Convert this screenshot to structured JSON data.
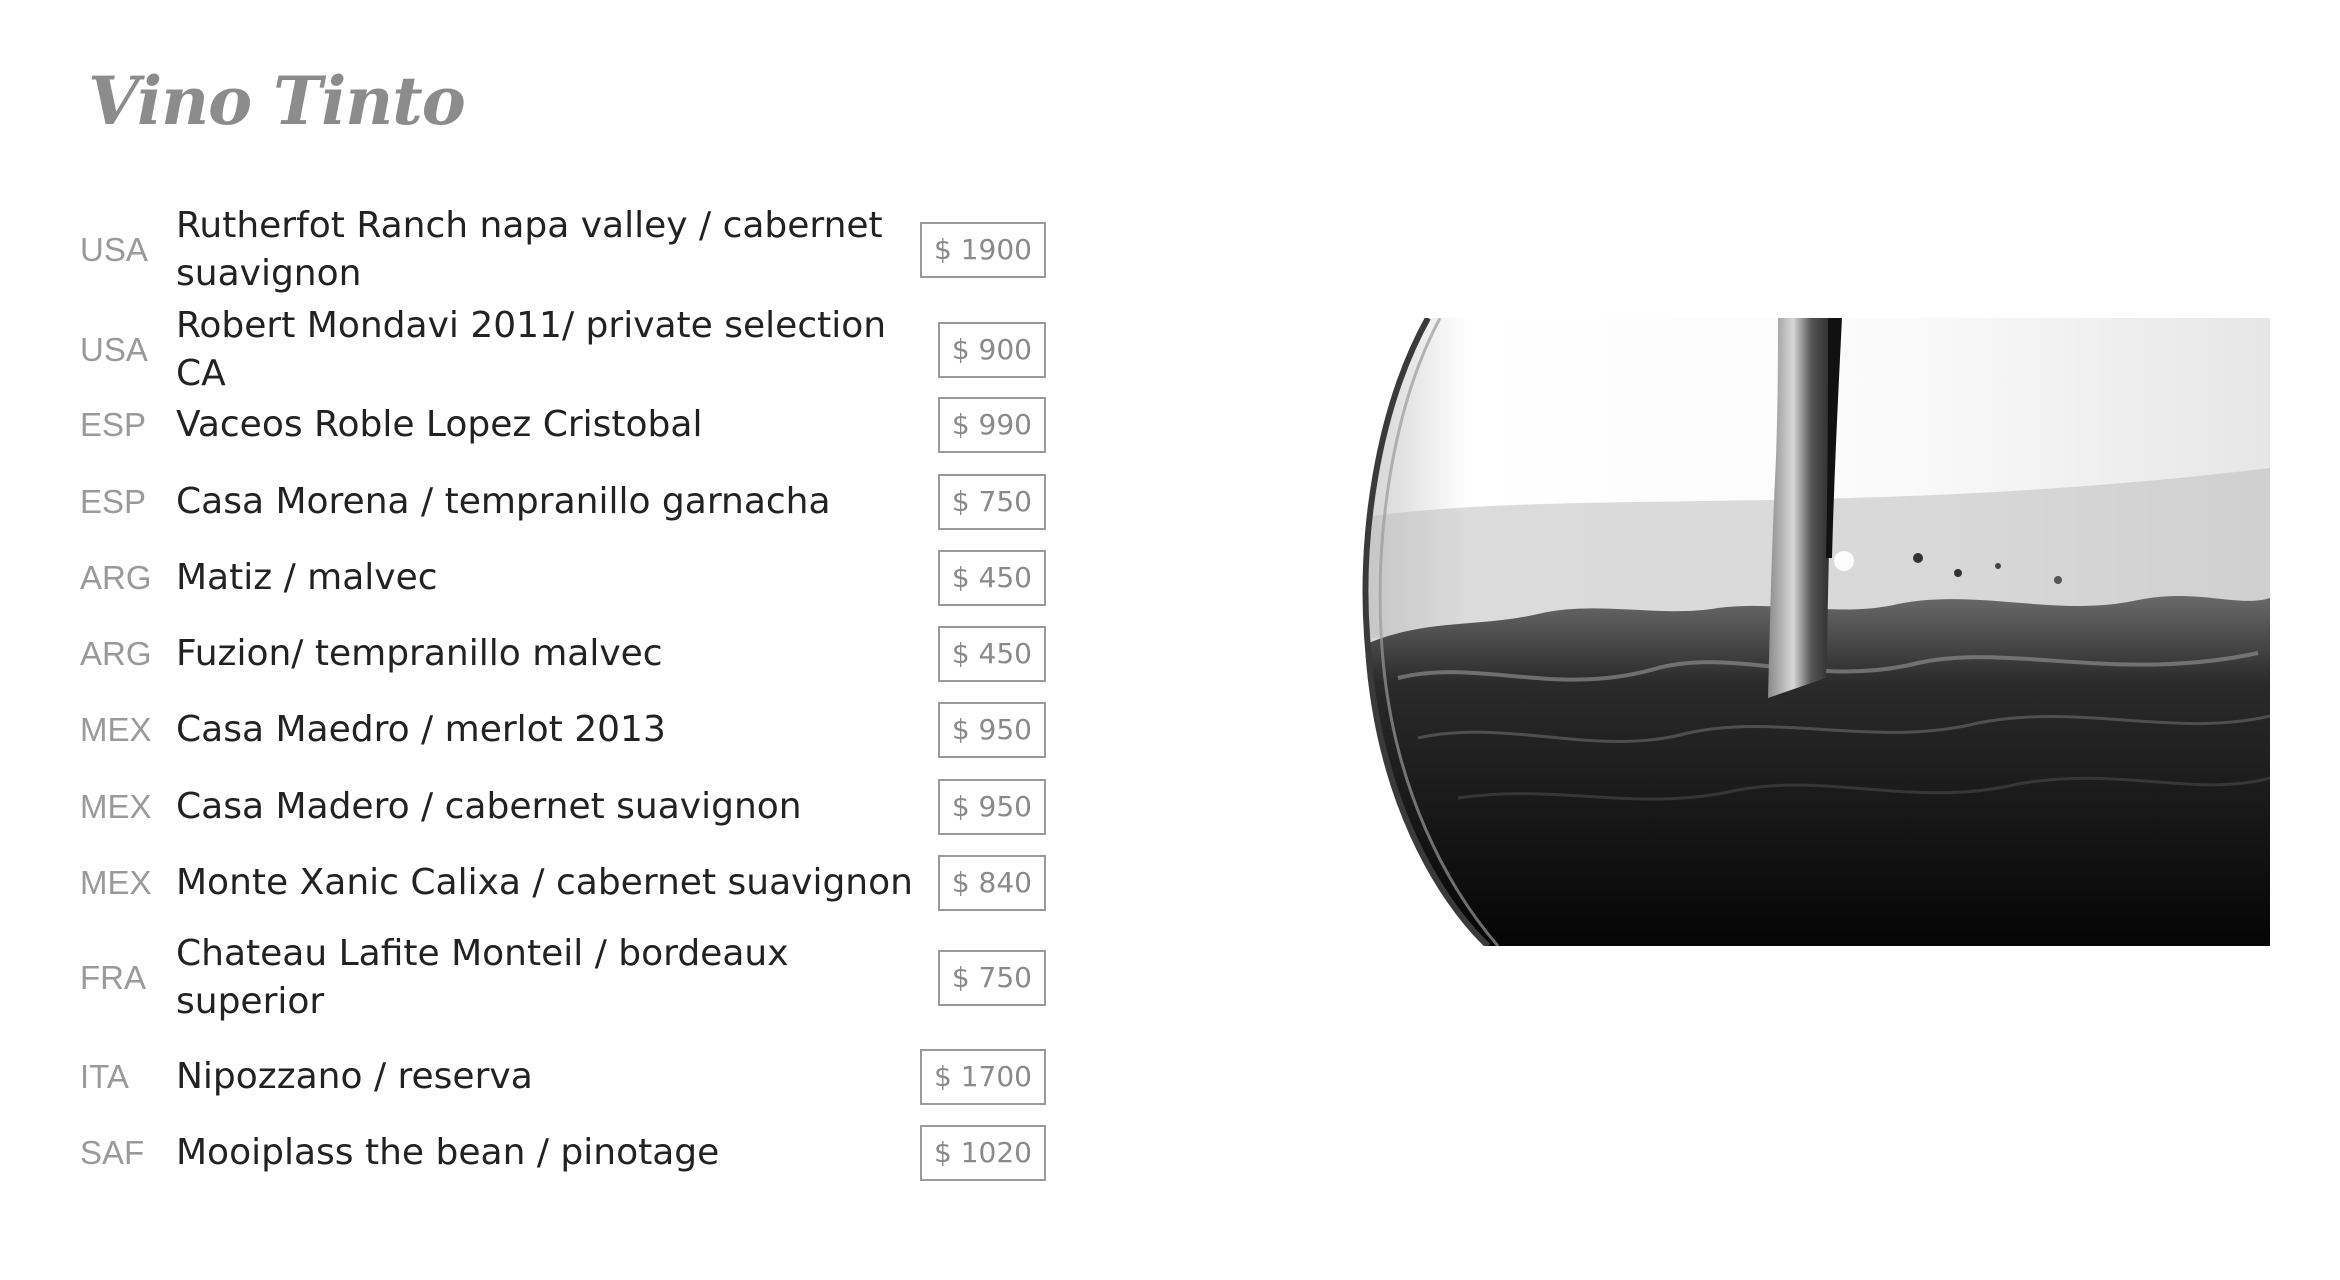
{
  "title": "Vino Tinto",
  "wines": [
    {
      "country": "USA",
      "name": "Rutherfot Ranch napa valley / cabernet suavignon",
      "price": "$ 1900"
    },
    {
      "country": "USA",
      "name": "Robert Mondavi 2011/ private selection CA",
      "price": "$ 900"
    },
    {
      "country": "ESP",
      "name": "Vaceos Roble Lopez Cristobal",
      "price": "$ 990"
    },
    {
      "country": "ESP",
      "name": "Casa Morena / tempranillo garnacha",
      "price": "$ 750"
    },
    {
      "country": "ARG",
      "name": "Matiz / malvec",
      "price": "$ 450"
    },
    {
      "country": "ARG",
      "name": "Fuzion/ tempranillo malvec",
      "price": "$ 450"
    },
    {
      "country": "MEX",
      "name": "Casa Maedro / merlot 2013",
      "price": "$ 950"
    },
    {
      "country": "MEX",
      "name": "Casa Madero / cabernet suavignon",
      "price": "$ 950"
    },
    {
      "country": "MEX",
      "name": "Monte Xanic Calixa / cabernet suavignon",
      "price": "$ 840"
    },
    {
      "country": "FRA",
      "name": "Chateau Lafite Monteil / bordeaux superior",
      "price": "$ 750"
    },
    {
      "country": "ITA",
      "name": "Nipozzano / reserva",
      "price": "$ 1700"
    },
    {
      "country": "SAF",
      "name": "Mooiplass the bean / pinotage",
      "price": "$ 1020"
    }
  ],
  "colors": {
    "title": "#8c8c8c",
    "country": "#9a9a9a",
    "name": "#222222",
    "price_border": "#9a9a9a"
  }
}
